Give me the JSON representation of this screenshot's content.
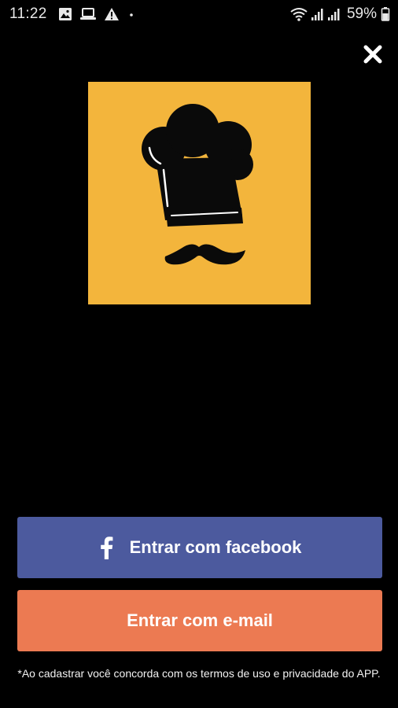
{
  "status_bar": {
    "time": "11:22",
    "battery": "59%",
    "left_icons": [
      "gallery-icon",
      "laptop-icon",
      "warning-icon",
      "dot-icon"
    ],
    "right_icons": [
      "wifi-icon",
      "signal-icon",
      "signal-icon",
      "battery-icon"
    ]
  },
  "logo": {
    "icon": "chef-hat-mustache-icon",
    "background_color": "#f3b53c"
  },
  "buttons": {
    "facebook_label": "Entrar com facebook",
    "facebook_icon": "facebook-icon",
    "facebook_color": "#4c5a9e",
    "email_label": "Entrar com e-mail",
    "email_color": "#ec7a52"
  },
  "terms_text": "*Ao cadastrar você concorda com os termos de uso e privacidade do APP."
}
